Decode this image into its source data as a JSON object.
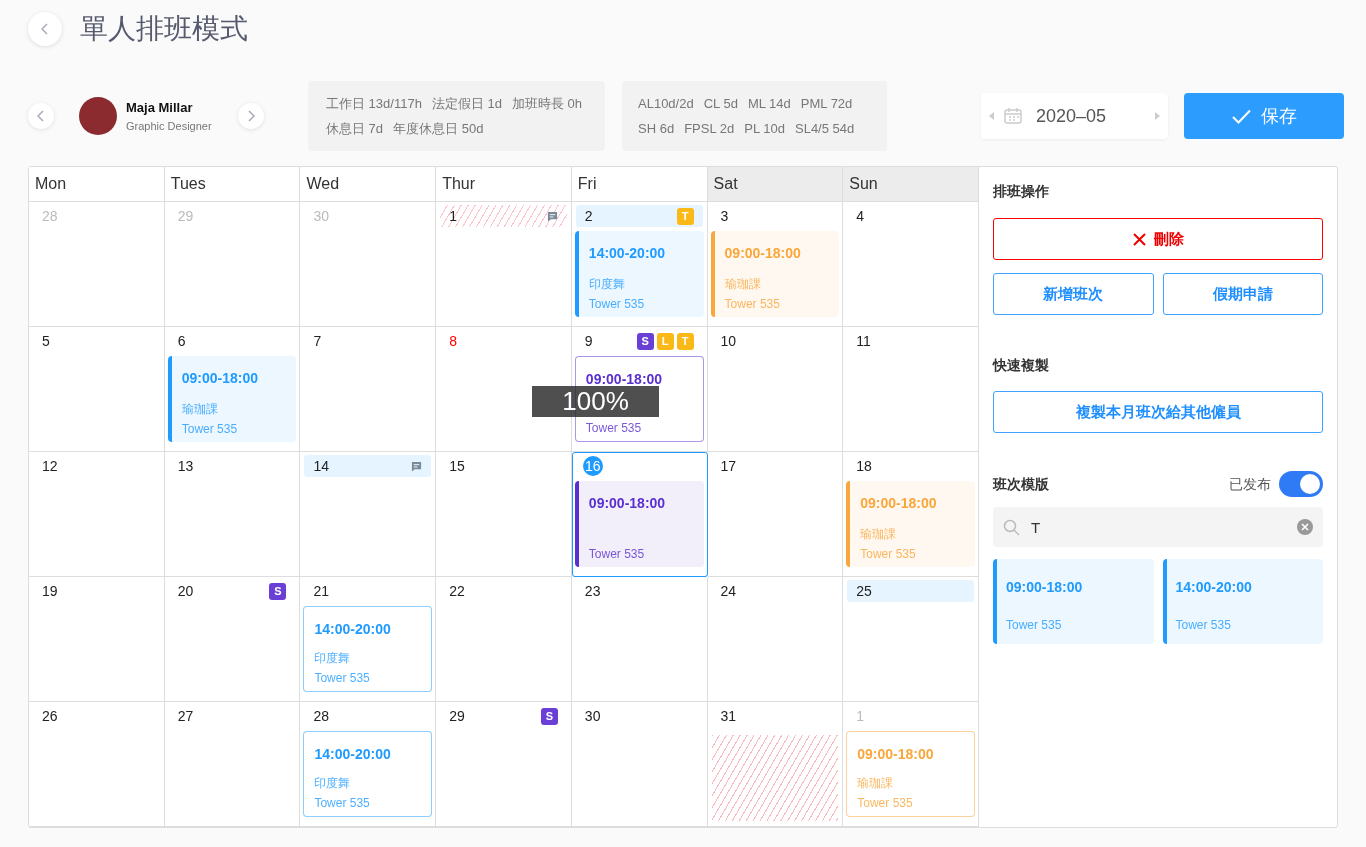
{
  "title": "單人排班模式",
  "employee": {
    "name": "Maja Millar",
    "role": "Graphic Designer"
  },
  "stats": [
    [
      "工作日 13d/117h",
      "法定假日 1d",
      "加班時長 0h"
    ],
    [
      "休息日 7d",
      "年度休息日 50d"
    ]
  ],
  "leave_stats": [
    [
      "AL10d/2d",
      "CL 5d",
      "ML 14d",
      "PML 72d"
    ],
    [
      "SH 6d",
      "FPSL 2d",
      "PL 10d",
      "SL4/5 54d"
    ]
  ],
  "month": "2020–05",
  "save_button": "保存",
  "columns": [
    {
      "label": "Mon",
      "weekend": false
    },
    {
      "label": "Tues",
      "weekend": false
    },
    {
      "label": "Wed",
      "weekend": false
    },
    {
      "label": "Thur",
      "weekend": false
    },
    {
      "label": "Fri",
      "weekend": false
    },
    {
      "label": "Sat",
      "weekend": true
    },
    {
      "label": "Sun",
      "weekend": true
    }
  ],
  "weeks": [
    [
      {
        "day": "28",
        "kind": "plain",
        "muted": true,
        "holiday": false,
        "today": false,
        "note": false
      },
      {
        "day": "29",
        "kind": "plain",
        "muted": true,
        "holiday": false,
        "today": false,
        "note": false
      },
      {
        "day": "30",
        "kind": "plain",
        "muted": true,
        "holiday": false,
        "today": false,
        "note": false
      },
      {
        "day": "1",
        "kind": "hatched",
        "muted": false,
        "holiday": false,
        "today": false,
        "note": true
      },
      {
        "day": "2",
        "kind": "highlighted",
        "muted": false,
        "holiday": false,
        "today": false,
        "note": false,
        "badges": [
          {
            "label": "T",
            "color": "#fbb917"
          }
        ],
        "shift": {
          "kind": "filled",
          "color": "#1f9bff",
          "time": "14:00-20:00",
          "activity": "印度舞",
          "location": "Tower 535"
        }
      },
      {
        "day": "3",
        "kind": "plain",
        "muted": false,
        "holiday": false,
        "today": false,
        "note": false,
        "shift": {
          "kind": "filled",
          "color": "#f9a63a",
          "time": "09:00-18:00",
          "activity": "瑜珈課",
          "location": "Tower 535"
        }
      },
      {
        "day": "4",
        "kind": "plain",
        "muted": false,
        "holiday": false,
        "today": false,
        "note": false
      }
    ],
    [
      {
        "day": "5",
        "kind": "plain",
        "muted": false,
        "holiday": false,
        "today": false,
        "note": false
      },
      {
        "day": "6",
        "kind": "plain",
        "muted": false,
        "holiday": false,
        "today": false,
        "note": false,
        "shift": {
          "kind": "filled",
          "color": "#1f9bff",
          "time": "09:00-18:00",
          "activity": "瑜珈課",
          "location": "Tower 535"
        }
      },
      {
        "day": "7",
        "kind": "plain",
        "muted": false,
        "holiday": false,
        "today": false,
        "note": false
      },
      {
        "day": "8",
        "kind": "plain",
        "muted": false,
        "holiday": true,
        "today": false,
        "note": false
      },
      {
        "day": "9",
        "kind": "plain",
        "muted": false,
        "holiday": false,
        "today": false,
        "note": false,
        "badges": [
          {
            "label": "S",
            "color": "#6a3fd6"
          },
          {
            "label": "L",
            "color": "#fbb917"
          },
          {
            "label": "T",
            "color": "#fbb917"
          }
        ],
        "shift": {
          "kind": "outlined",
          "color": "#5a2fd0",
          "time": "09:00-18:00",
          "location": "Tower 535"
        }
      },
      {
        "day": "10",
        "kind": "plain",
        "muted": false,
        "holiday": false,
        "today": false,
        "note": false
      },
      {
        "day": "11",
        "kind": "plain",
        "muted": false,
        "holiday": false,
        "today": false,
        "note": false
      }
    ],
    [
      {
        "day": "12",
        "kind": "plain",
        "muted": false,
        "holiday": false,
        "today": false,
        "note": false
      },
      {
        "day": "13",
        "kind": "plain",
        "muted": false,
        "holiday": false,
        "today": false,
        "note": false
      },
      {
        "day": "14",
        "kind": "highlighted",
        "muted": false,
        "holiday": false,
        "today": false,
        "note": true
      },
      {
        "day": "15",
        "kind": "plain",
        "muted": false,
        "holiday": false,
        "today": false,
        "note": false
      },
      {
        "day": "16",
        "kind": "plain",
        "muted": false,
        "holiday": false,
        "today": true,
        "note": false,
        "shift": {
          "kind": "filled",
          "color": "#5a2fd0",
          "time": "09:00-18:00",
          "location": "Tower 535"
        }
      },
      {
        "day": "17",
        "kind": "plain",
        "muted": false,
        "holiday": false,
        "today": false,
        "note": false
      },
      {
        "day": "18",
        "kind": "plain",
        "muted": false,
        "holiday": false,
        "today": false,
        "note": false,
        "shift": {
          "kind": "filled",
          "color": "#f9a63a",
          "time": "09:00-18:00",
          "activity": "瑜珈課",
          "location": "Tower 535"
        }
      }
    ],
    [
      {
        "day": "19",
        "kind": "plain",
        "muted": false,
        "holiday": false,
        "today": false,
        "note": false
      },
      {
        "day": "20",
        "kind": "plain",
        "muted": false,
        "holiday": false,
        "today": false,
        "note": false,
        "badges": [
          {
            "label": "S",
            "color": "#6a3fd6"
          }
        ]
      },
      {
        "day": "21",
        "kind": "plain",
        "muted": false,
        "holiday": false,
        "today": false,
        "note": false,
        "shift": {
          "kind": "outlined",
          "color": "#1f9bff",
          "time": "14:00-20:00",
          "activity": "印度舞",
          "location": "Tower 535"
        }
      },
      {
        "day": "22",
        "kind": "plain",
        "muted": false,
        "holiday": false,
        "today": false,
        "note": false
      },
      {
        "day": "23",
        "kind": "plain",
        "muted": false,
        "holiday": false,
        "today": false,
        "note": false
      },
      {
        "day": "24",
        "kind": "plain",
        "muted": false,
        "holiday": false,
        "today": false,
        "note": false
      },
      {
        "day": "25",
        "kind": "highlighted",
        "muted": false,
        "holiday": false,
        "today": false,
        "note": false
      }
    ],
    [
      {
        "day": "26",
        "kind": "plain",
        "muted": false,
        "holiday": false,
        "today": false,
        "note": false
      },
      {
        "day": "27",
        "kind": "plain",
        "muted": false,
        "holiday": false,
        "today": false,
        "note": false
      },
      {
        "day": "28",
        "kind": "plain",
        "muted": false,
        "holiday": false,
        "today": false,
        "note": false,
        "shift": {
          "kind": "outlined",
          "color": "#1f9bff",
          "time": "14:00-20:00",
          "activity": "印度舞",
          "location": "Tower 535"
        }
      },
      {
        "day": "29",
        "kind": "plain",
        "muted": false,
        "holiday": false,
        "today": false,
        "note": false,
        "badges": [
          {
            "label": "S",
            "color": "#6a3fd6"
          }
        ]
      },
      {
        "day": "30",
        "kind": "plain",
        "muted": false,
        "holiday": false,
        "today": false,
        "note": false
      },
      {
        "day": "31",
        "kind": "plain",
        "muted": false,
        "holiday": false,
        "today": false,
        "note": false,
        "shift": {
          "kind": "blocked",
          "color": "#f9b9c0"
        }
      },
      {
        "day": "1",
        "kind": "plain",
        "muted": true,
        "holiday": false,
        "today": false,
        "note": false,
        "shift": {
          "kind": "outlined",
          "color": "#f9a63a",
          "time": "09:00-18:00",
          "activity": "瑜珈課",
          "location": "Tower 535"
        }
      }
    ]
  ],
  "zoom_overlay": "100%",
  "panel": {
    "operations_title": "排班操作",
    "delete_button": "刪除",
    "add_shift_button": "新增班次",
    "leave_button": "假期申請",
    "copy_title": "快速複製",
    "copy_button": "複製本月班次給其他僱員",
    "templates_title": "班次模版",
    "published_label": "已发布",
    "published": true,
    "search_value": "T",
    "templates": [
      {
        "time": "09:00-18:00",
        "location": "Tower 535",
        "color": "#1f9bff"
      },
      {
        "time": "14:00-20:00",
        "location": "Tower 535",
        "color": "#1f9bff"
      }
    ]
  }
}
